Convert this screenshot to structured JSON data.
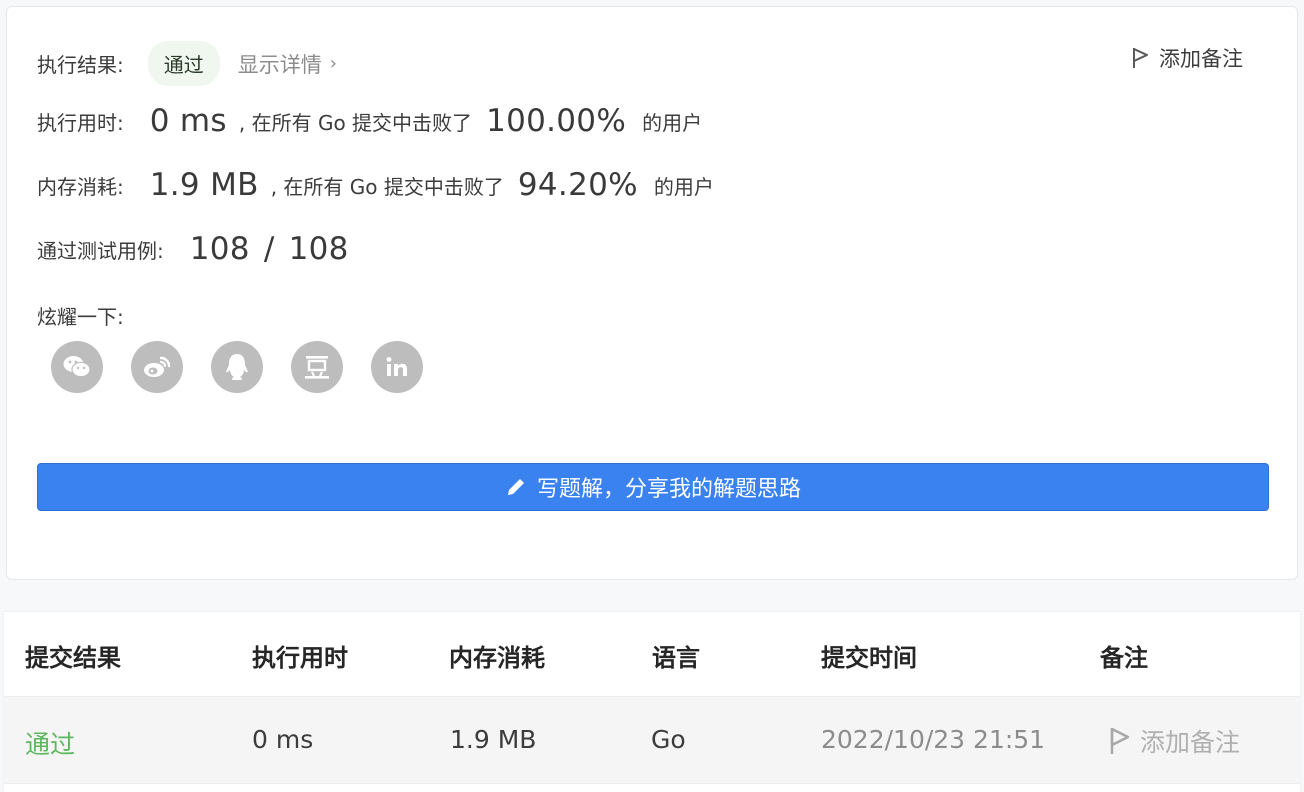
{
  "result": {
    "status_label": "执行结果:",
    "status_value": "通过",
    "detail_link": "显示详情",
    "add_note": "添加备注"
  },
  "runtime": {
    "label": "执行用时:",
    "value": "0 ms",
    "mid_text": ", 在所有 Go 提交中击败了",
    "percent": "100.00%",
    "suffix": "的用户"
  },
  "memory": {
    "label": "内存消耗:",
    "value": "1.9 MB",
    "mid_text": ", 在所有 Go 提交中击败了",
    "percent": "94.20%",
    "suffix": "的用户"
  },
  "tests": {
    "label": "通过测试用例:",
    "passed": "108",
    "separator": "/",
    "total": "108"
  },
  "share": {
    "label": "炫耀一下:",
    "icons": [
      "wechat-icon",
      "weibo-icon",
      "qq-icon",
      "douban-icon",
      "linkedin-icon"
    ]
  },
  "write_solution_label": "写题解，分享我的解题思路",
  "table": {
    "headers": [
      "提交结果",
      "执行用时",
      "内存消耗",
      "语言",
      "提交时间",
      "备注"
    ],
    "rows": [
      {
        "result": "通过",
        "runtime": "0 ms",
        "memory": "1.9 MB",
        "language": "Go",
        "time": "2022/10/23 21:51",
        "note": "添加备注"
      }
    ]
  },
  "colors": {
    "accent_blue": "#3a82f0",
    "pass_green": "#5cb85c",
    "icon_gray": "#bdbdbd"
  }
}
